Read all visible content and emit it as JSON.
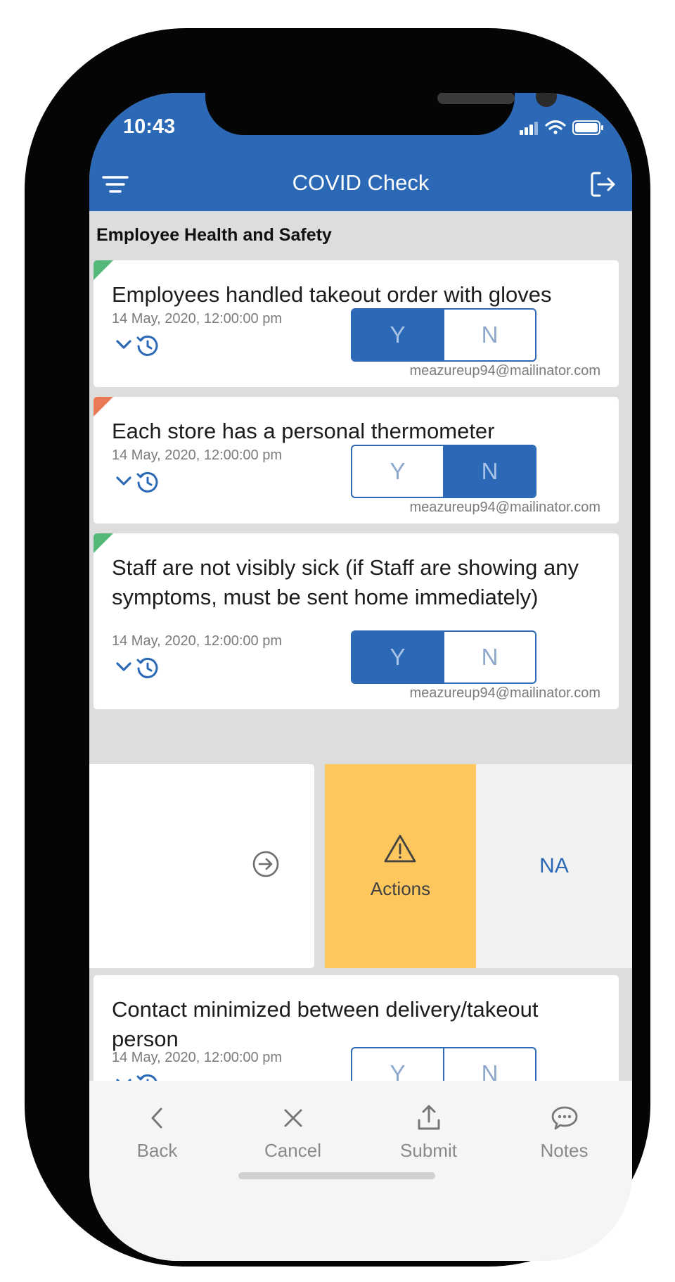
{
  "status_bar": {
    "time": "10:43"
  },
  "header": {
    "title": "COVID Check",
    "left_icon": "filter-icon",
    "right_icon": "logout-icon"
  },
  "section": {
    "title": "Employee Health and Safety"
  },
  "colors": {
    "primary": "#2b68b5",
    "flag_pass": "#53b87a",
    "flag_fail": "#ea7a55",
    "actions_bg": "#fdc75d"
  },
  "questions": [
    {
      "text": "Employees handled takeout order with gloves",
      "date": "14 May, 2020, 12:00:00 pm",
      "email": "meazureup94@mailinator.com",
      "yes_label": "Y",
      "no_label": "N",
      "answer": "Y",
      "flag": "pass"
    },
    {
      "text": "Each store has a personal thermometer",
      "date": "14 May, 2020, 12:00:00 pm",
      "email": "meazureup94@mailinator.com",
      "yes_label": "Y",
      "no_label": "N",
      "answer": "N",
      "flag": "fail"
    },
    {
      "text": "Staff are not visibly sick (if Staff are showing any symptoms, must be sent home immediately)",
      "date": "14 May, 2020, 12:00:00 pm",
      "email": "meazureup94@mailinator.com",
      "yes_label": "Y",
      "no_label": "N",
      "answer": "Y",
      "flag": "pass"
    },
    {
      "text": "Contact minimized between delivery/takeout person",
      "date": "14 May, 2020, 12:00:00 pm",
      "yes_label": "Y",
      "no_label": "N",
      "answer": ""
    }
  ],
  "swipe_row": {
    "actions_label": "Actions",
    "na_label": "NA"
  },
  "tabbar": {
    "back": "Back",
    "cancel": "Cancel",
    "submit": "Submit",
    "notes": "Notes"
  }
}
